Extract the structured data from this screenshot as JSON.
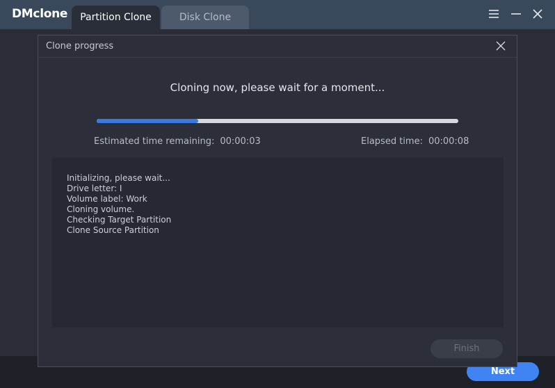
{
  "app": {
    "brand": "DMclone",
    "tabs": [
      {
        "label": "Partition Clone",
        "active": true
      },
      {
        "label": "Disk Clone",
        "active": false
      }
    ]
  },
  "footer": {
    "next_label": "Next"
  },
  "dialog": {
    "title": "Clone progress",
    "status": "Cloning now, please wait for a moment...",
    "progress": 0.28,
    "estimated_label": "Estimated time remaining:",
    "estimated_value": "00:00:03",
    "elapsed_label": "Elapsed time:",
    "elapsed_value": "00:00:08",
    "log": [
      "Initializing, please wait...",
      "Drive letter: I",
      "Volume label: Work",
      "Cloning volume.",
      "Checking Target Partition",
      "Clone Source Partition"
    ],
    "finish_label": "Finish"
  },
  "colors": {
    "accent": "#3f84f2",
    "progress": "#3a7ae0",
    "appbar": "#39485a"
  }
}
